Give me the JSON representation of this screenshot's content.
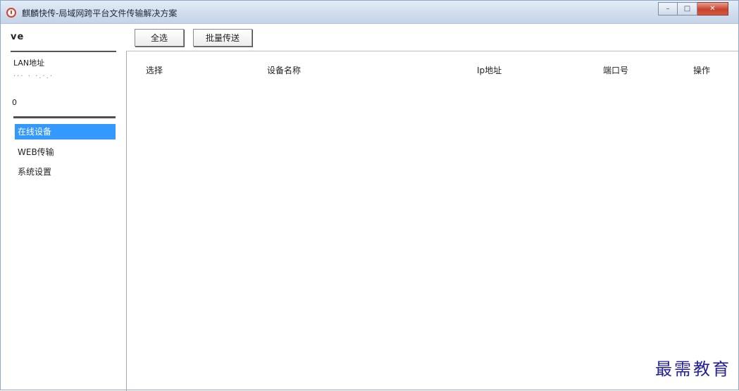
{
  "window": {
    "title": "麒麟快传-局域网跨平台文件传输解决方案",
    "controls": {
      "minimize": "–",
      "maximize": "□",
      "close": "✕"
    }
  },
  "toolbar": {
    "device_label": "ve",
    "select_all": "全选",
    "batch_send": "批量传送"
  },
  "sidebar": {
    "lan_label": "LAN地址",
    "lan_value": "···  ·  ·.·.·",
    "count": "0",
    "items": [
      {
        "label": "在线设备",
        "active": true
      },
      {
        "label": "WEB传输",
        "active": false
      },
      {
        "label": "系统设置",
        "active": false
      }
    ]
  },
  "table": {
    "columns": [
      "选择",
      "设备名称",
      "Ip地址",
      "端口号",
      "操作"
    ],
    "rows": []
  },
  "watermark": "最需教育",
  "colors": {
    "active_item": "#3399ff",
    "titlebar": "#cfdcec",
    "watermark": "#24219a"
  }
}
